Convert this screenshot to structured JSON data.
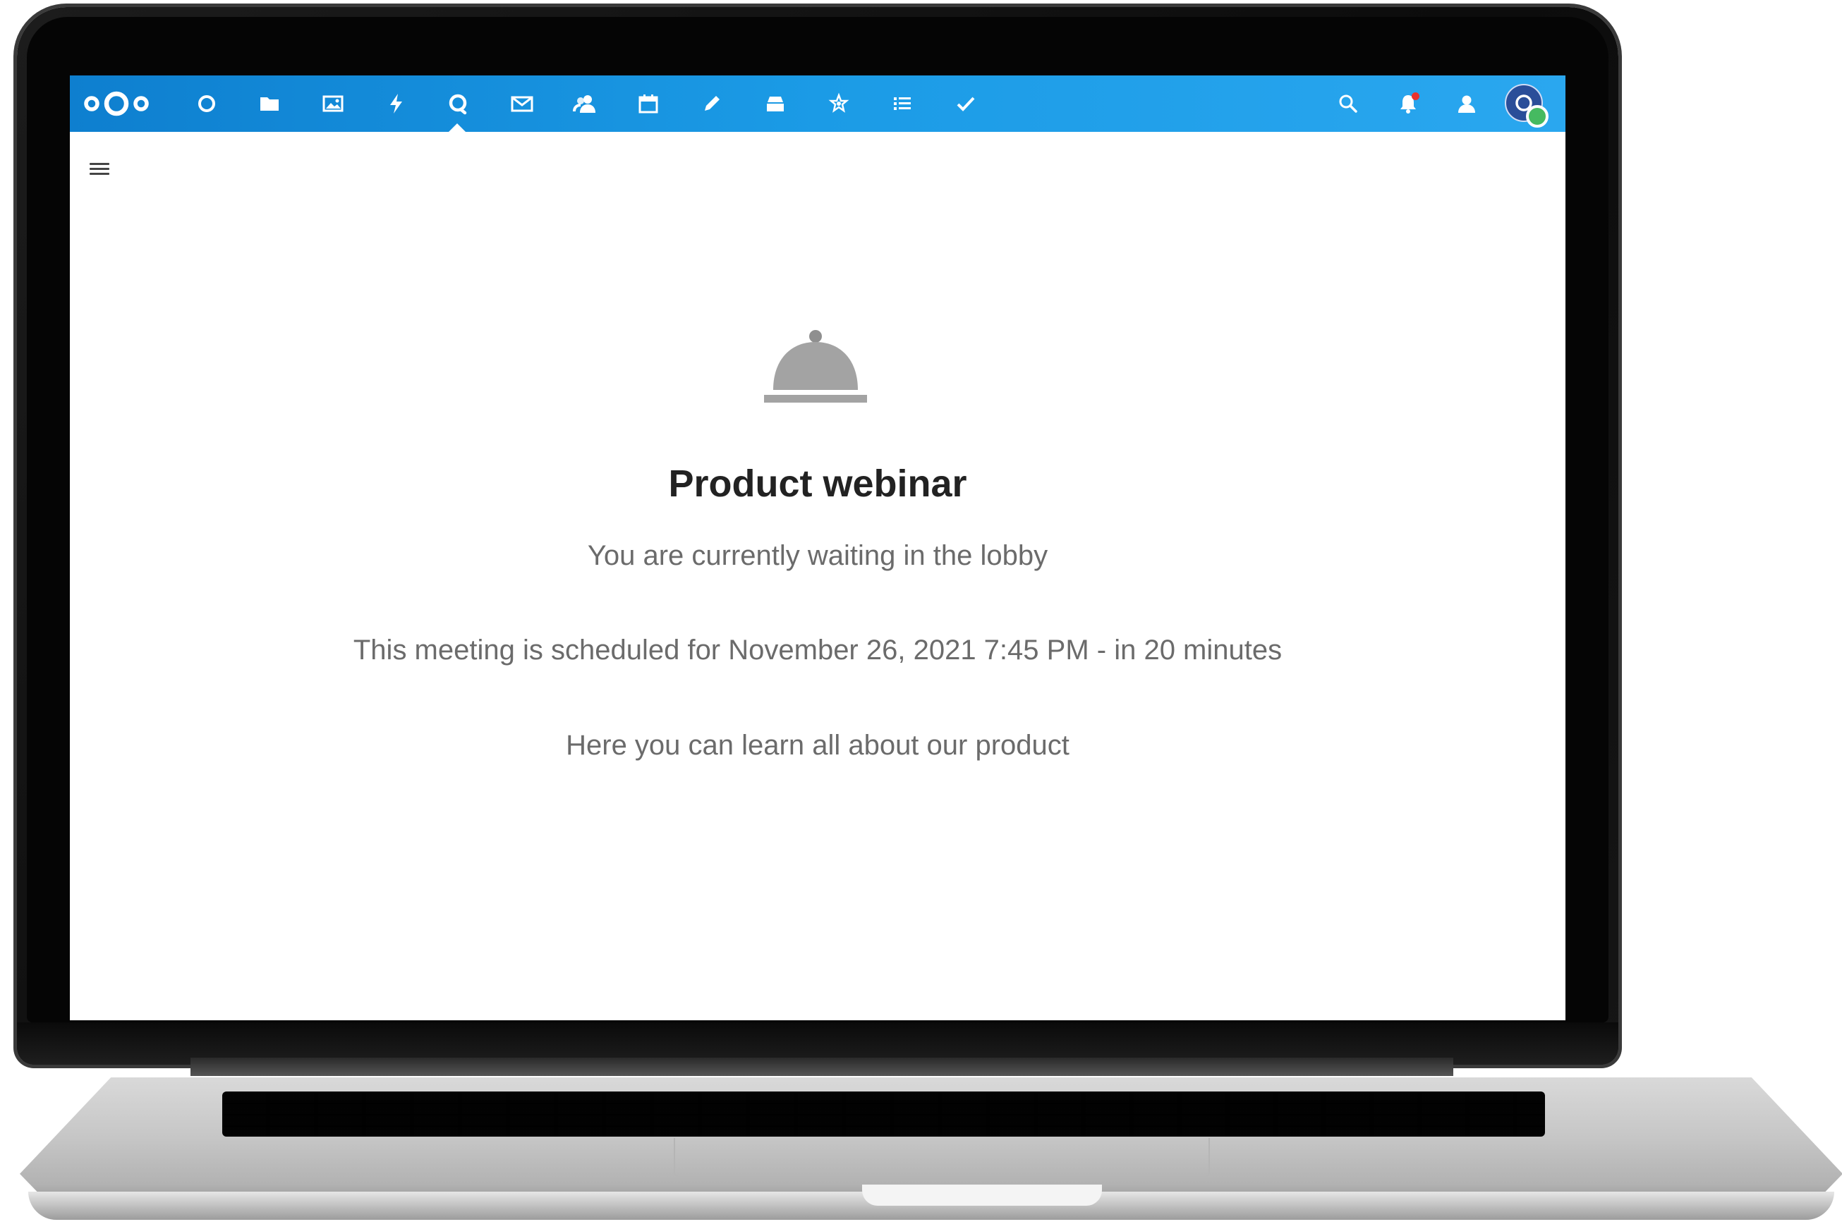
{
  "window": {
    "app": "Nextcloud Talk"
  },
  "header": {
    "logo_icon": "nextcloud-logo-icon",
    "apps": [
      {
        "name": "dashboard",
        "icon": "dashboard-circle-icon"
      },
      {
        "name": "files",
        "icon": "folder-icon"
      },
      {
        "name": "photos",
        "icon": "image-icon"
      },
      {
        "name": "activity",
        "icon": "lightning-icon"
      },
      {
        "name": "talk",
        "icon": "talk-icon",
        "active": true
      },
      {
        "name": "mail",
        "icon": "envelope-icon"
      },
      {
        "name": "contacts",
        "icon": "contacts-icon"
      },
      {
        "name": "calendar",
        "icon": "calendar-icon"
      },
      {
        "name": "notes",
        "icon": "pencil-icon"
      },
      {
        "name": "deck",
        "icon": "deck-icon"
      },
      {
        "name": "circles",
        "icon": "star-network-icon"
      },
      {
        "name": "list",
        "icon": "list-icon"
      },
      {
        "name": "tasks",
        "icon": "checkmark-icon"
      }
    ],
    "right_icons": [
      "search-icon",
      "notification-bell-icon",
      "contacts-menu-icon"
    ],
    "notification_dot_color": "#e9322d",
    "user_status": "online",
    "status_color": "#46ba61",
    "accent_color": "#1b9be6"
  },
  "lobby": {
    "icon": "lobby-bell-icon",
    "title": "Product webinar",
    "waiting_text": "You are currently waiting in the lobby",
    "schedule_text": "This meeting is scheduled for November 26, 2021 7:45 PM - in 20 minutes",
    "description": "Here you can learn all about our product"
  }
}
